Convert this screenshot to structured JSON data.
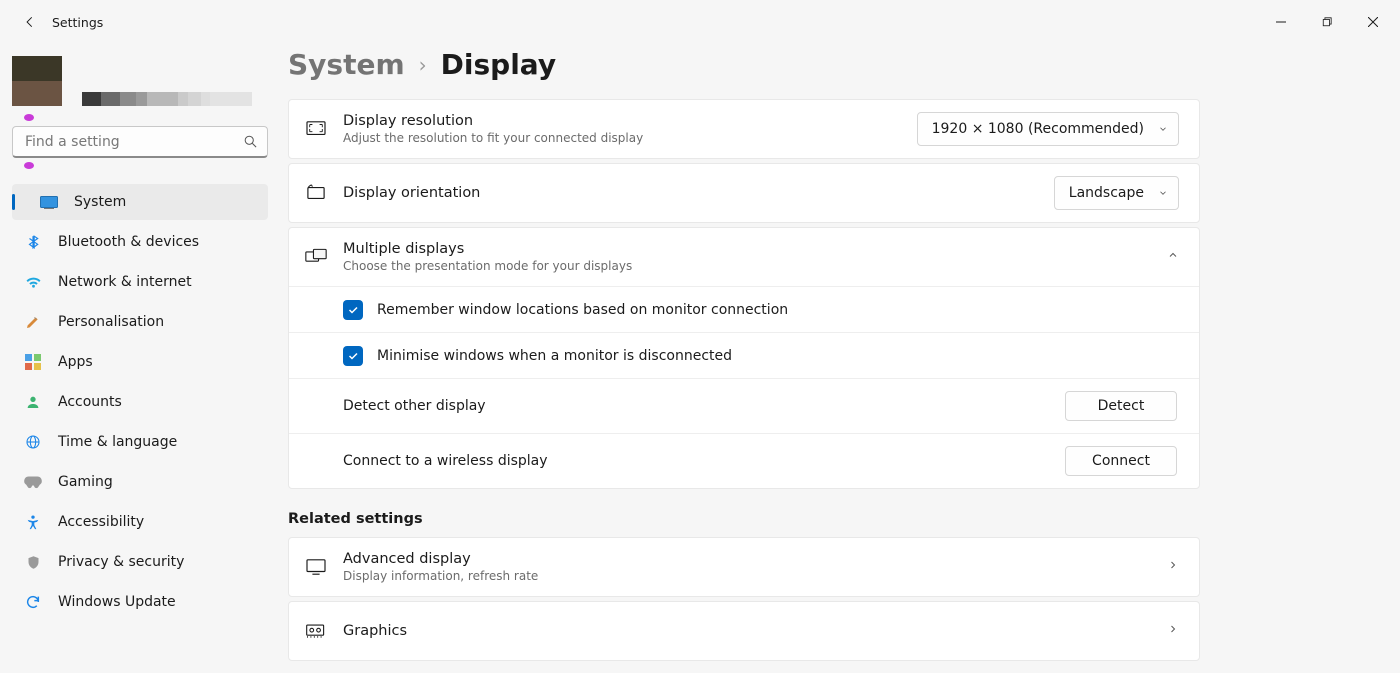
{
  "window": {
    "title": "Settings"
  },
  "search": {
    "placeholder": "Find a setting"
  },
  "sidebar": {
    "items": [
      {
        "label": "System"
      },
      {
        "label": "Bluetooth & devices"
      },
      {
        "label": "Network & internet"
      },
      {
        "label": "Personalisation"
      },
      {
        "label": "Apps"
      },
      {
        "label": "Accounts"
      },
      {
        "label": "Time & language"
      },
      {
        "label": "Gaming"
      },
      {
        "label": "Accessibility"
      },
      {
        "label": "Privacy & security"
      },
      {
        "label": "Windows Update"
      }
    ]
  },
  "breadcrumb": {
    "root": "System",
    "leaf": "Display"
  },
  "rows": {
    "resolution": {
      "title": "Display resolution",
      "sub": "Adjust the resolution to fit your connected display",
      "value": "1920 × 1080 (Recommended)"
    },
    "orientation": {
      "title": "Display orientation",
      "value": "Landscape"
    },
    "multi": {
      "title": "Multiple displays",
      "sub": "Choose the presentation mode for your displays",
      "opt_remember": "Remember window locations based on monitor connection",
      "opt_minimise": "Minimise windows when a monitor is disconnected",
      "detect_label": "Detect other display",
      "detect_btn": "Detect",
      "connect_label": "Connect to a wireless display",
      "connect_btn": "Connect"
    }
  },
  "related": {
    "heading": "Related settings",
    "advanced": {
      "title": "Advanced display",
      "sub": "Display information, refresh rate"
    },
    "graphics": {
      "title": "Graphics"
    }
  }
}
